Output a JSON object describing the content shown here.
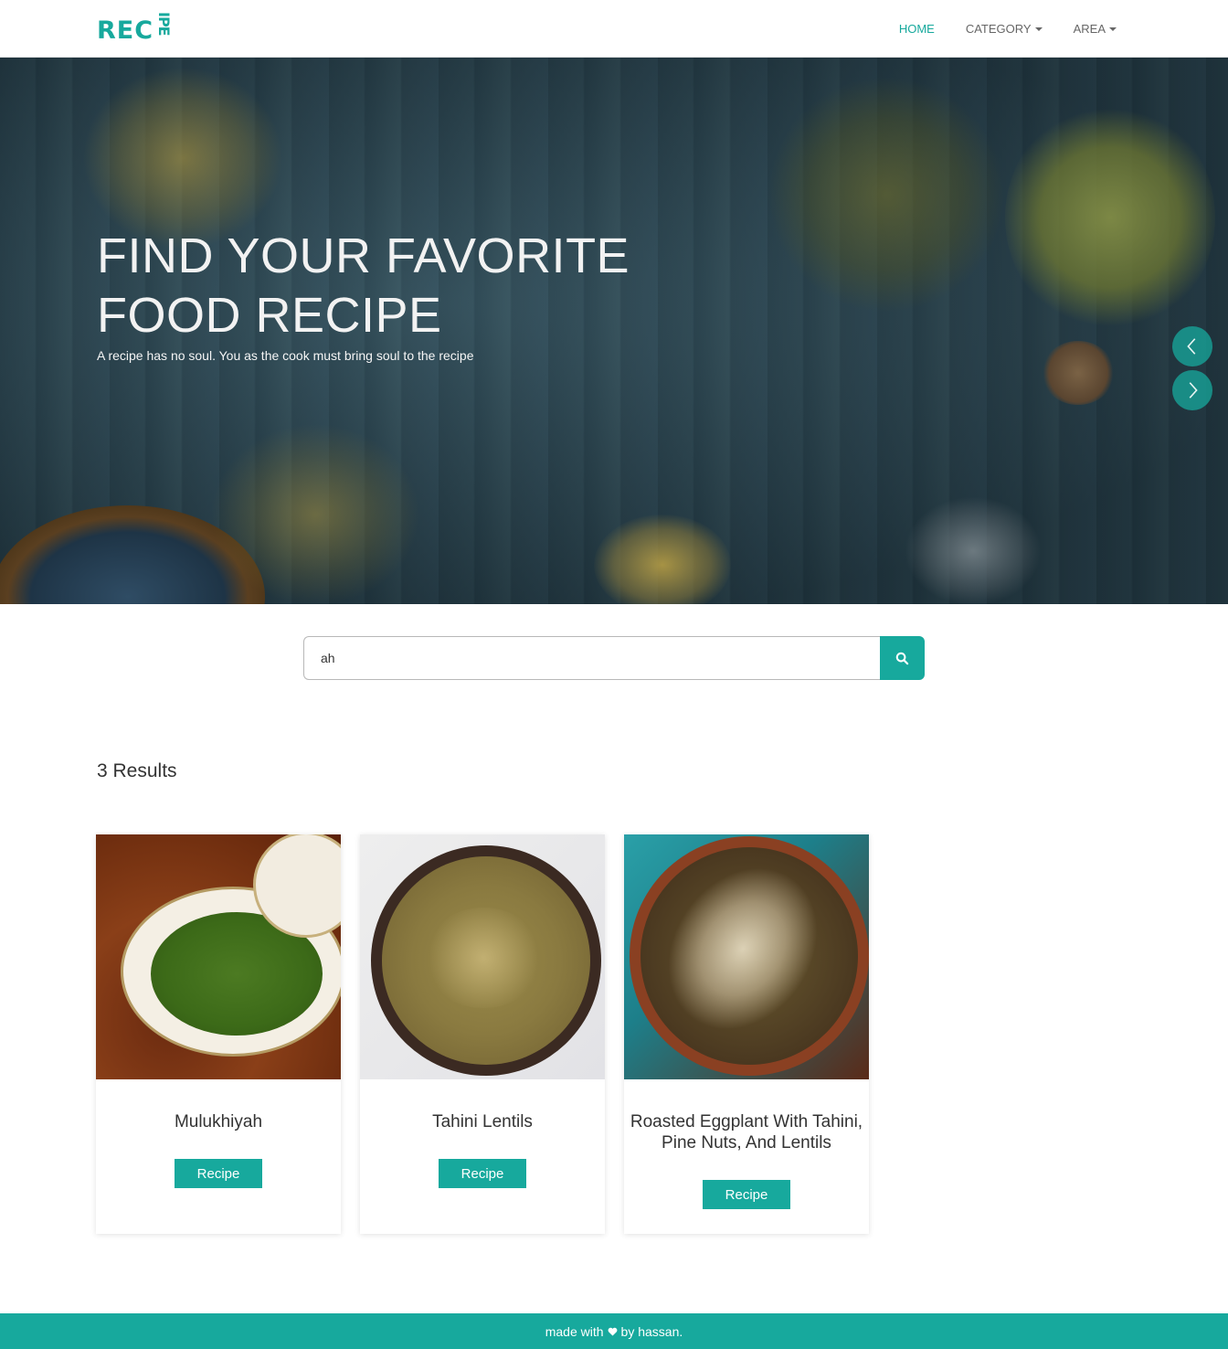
{
  "brand": {
    "logo_main": "REC",
    "logo_rotated": "IPE",
    "color": "#17a99d"
  },
  "nav": {
    "items": [
      {
        "label": "HOME",
        "active": true
      },
      {
        "label": "CATEGORY",
        "dropdown": true
      },
      {
        "label": "AREA",
        "dropdown": true
      }
    ]
  },
  "hero": {
    "title": "FIND YOUR FAVORITE FOOD RECIPE",
    "subtitle": "A recipe has no soul. You as the cook must bring soul to the recipe",
    "prev_icon": "chevron-left-icon",
    "next_icon": "chevron-right-icon"
  },
  "search": {
    "value": "ah",
    "icon": "search-icon"
  },
  "results": {
    "count_label": "3 Results",
    "cards": [
      {
        "title": "Mulukhiyah",
        "button": "Recipe"
      },
      {
        "title": "Tahini Lentils",
        "button": "Recipe"
      },
      {
        "title": "Roasted Eggplant With Tahini, Pine Nuts, And Lentils",
        "button": "Recipe"
      }
    ]
  },
  "footer": {
    "prefix": "made with",
    "icon": "heart-icon",
    "suffix": "by hassan."
  }
}
